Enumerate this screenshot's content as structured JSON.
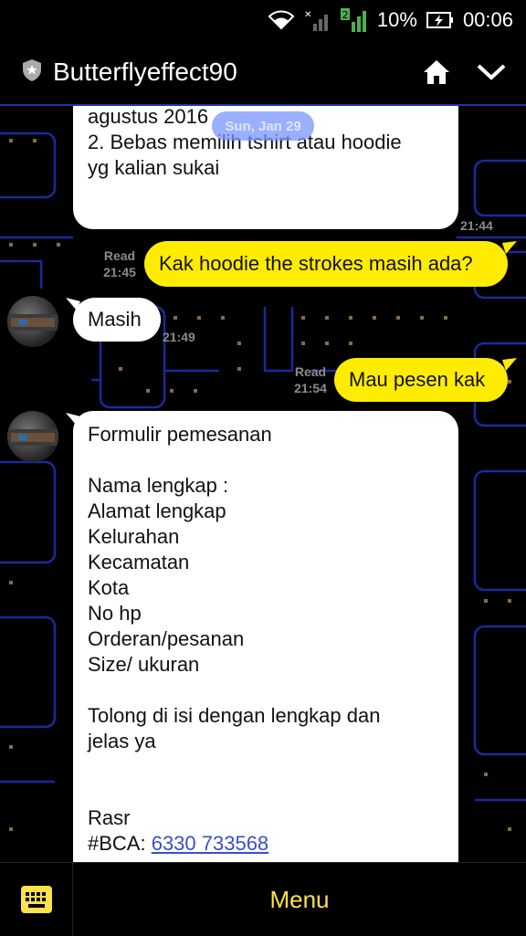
{
  "status_bar": {
    "battery_percent": "10%",
    "time": "00:06",
    "sim_number": "2"
  },
  "header": {
    "title": "Butterflyeffect90",
    "shield_icon": "shield-icon",
    "home_icon": "home-icon",
    "chevron_icon": "chevron-down-icon"
  },
  "chat": {
    "date_pill": "Sun, Jan 29",
    "messages": [
      {
        "side": "in",
        "lines": [
          "agustus 2016",
          "2. Bebas memilih tshirt atau hoodie",
          "yg kalian sukai"
        ],
        "time": "21:44"
      },
      {
        "side": "out",
        "text": "Kak hoodie the strokes masih ada?",
        "read": "Read",
        "time": "21:45"
      },
      {
        "side": "in",
        "text": "Masih",
        "time": "21:49"
      },
      {
        "side": "out",
        "text": "Mau pesen kak",
        "read": "Read",
        "time": "21:54"
      },
      {
        "side": "in",
        "lines": [
          "Formulir pemesanan",
          "",
          "Nama lengkap :",
          "Alamat lengkap",
          "Kelurahan",
          "Kecamatan",
          "Kota",
          "No hp",
          "Orderan/pesanan",
          "Size/ ukuran",
          "",
          "Tolong di isi dengan lengkap dan",
          "jelas ya",
          "",
          "",
          "Rasr"
        ],
        "bca_label": "#BCA: ",
        "bca_number": "6330 733568"
      }
    ]
  },
  "bottom_bar": {
    "keyboard_icon": "keyboard-icon",
    "menu_label": "Menu"
  },
  "colors": {
    "accent_yellow": "#ffec00",
    "menu_text": "#ffe14a",
    "maze_blue": "#1a2a9c",
    "link": "#3b4fc9"
  }
}
